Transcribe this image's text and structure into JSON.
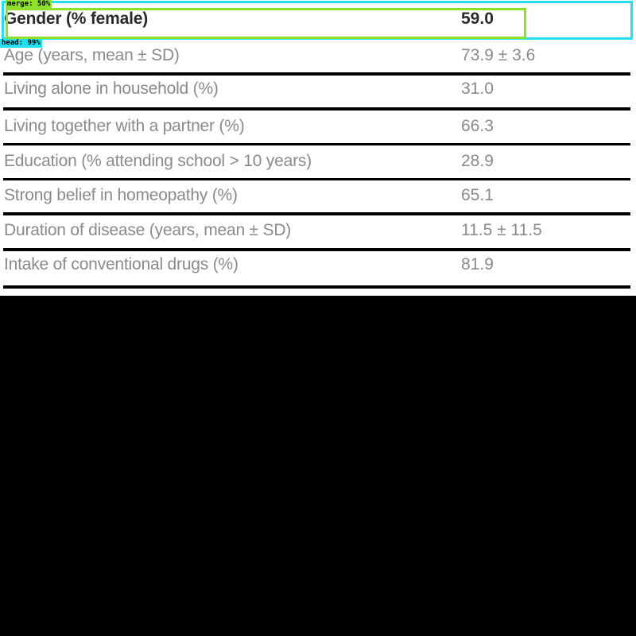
{
  "table": {
    "rows": [
      {
        "label": "Gender (% female)",
        "value": "59.0"
      },
      {
        "label": "Age (years, mean ± SD)",
        "value": "73.9 ± 3.6"
      },
      {
        "label": "Living alone in household (%)",
        "value": "31.0"
      },
      {
        "label": "Living together with a partner (%)",
        "value": "66.3"
      },
      {
        "label": "Education (% attending school > 10 years)",
        "value": "28.9"
      },
      {
        "label": "Strong belief in homeopathy (%)",
        "value": "65.1"
      },
      {
        "label": "Duration of disease (years, mean ± SD)",
        "value": "11.5 ± 11.5"
      },
      {
        "label": "Intake of conventional drugs (%)",
        "value": "81.9"
      }
    ]
  },
  "detections": {
    "merge_label": "merge: 50%",
    "head_label": "head: 99%"
  },
  "colors": {
    "head_box": "#22e0f0",
    "merge_box": "#8ee02a",
    "background": "#000000"
  }
}
